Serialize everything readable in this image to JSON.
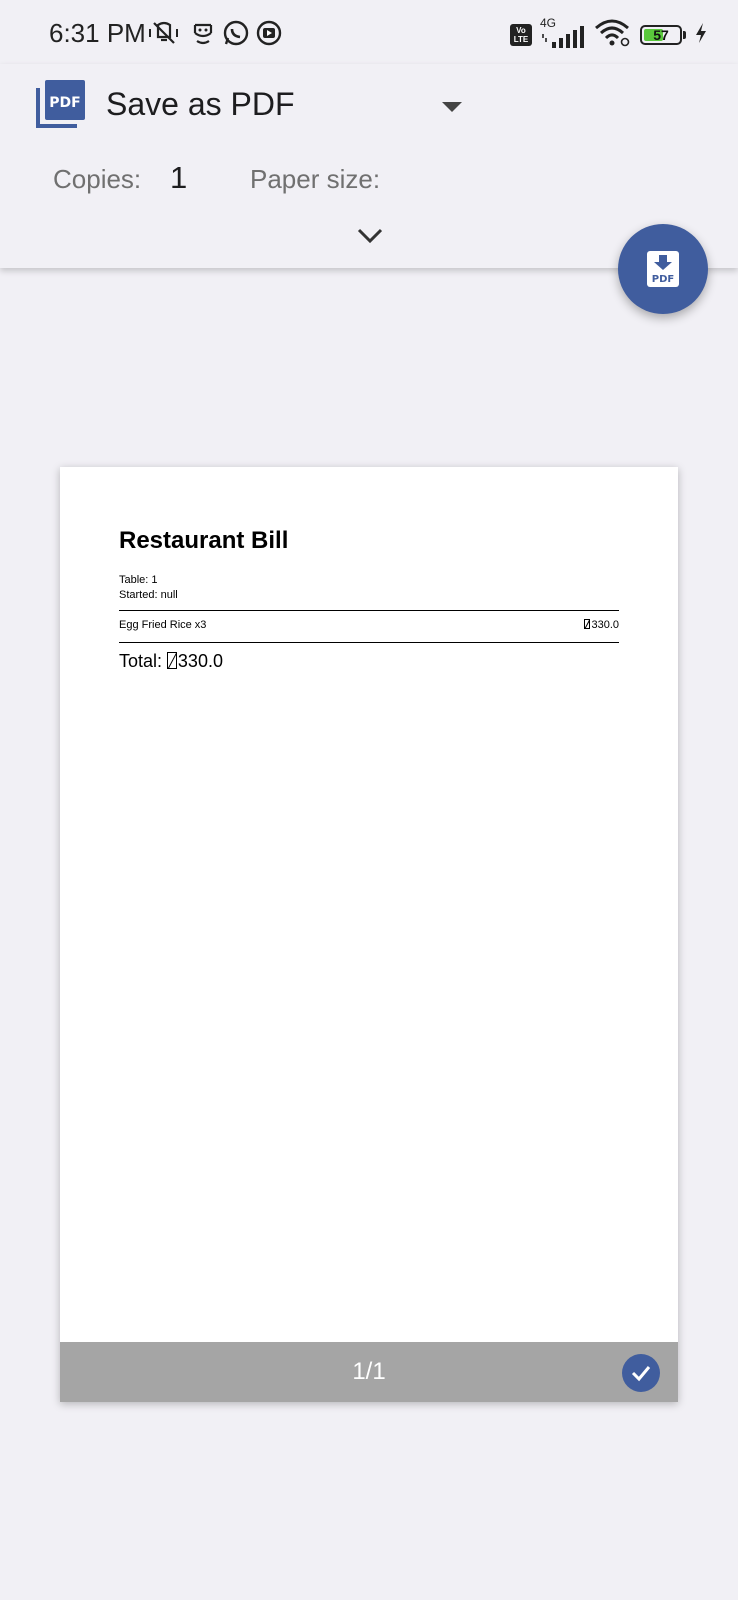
{
  "status_bar": {
    "time": "6:31 PM",
    "icons": [
      "vibrate-mute-icon",
      "face-icon",
      "whatsapp-icon",
      "youtube-icon"
    ],
    "network": "4G",
    "volte": "Vo LTE",
    "battery": "57",
    "battery_level": 57
  },
  "header": {
    "printer_icon_text": "PDF",
    "printer_name": "Save as PDF",
    "copies_label": "Copies:",
    "copies_value": "1",
    "paper_size_label": "Paper size:"
  },
  "fab": {
    "icon": "pdf-download-icon",
    "label": "PDF"
  },
  "preview": {
    "title": "Restaurant Bill",
    "table": "Table: 1",
    "started": "Started: null",
    "items": [
      {
        "name": "Egg Fried Rice x3",
        "price": "330.0"
      }
    ],
    "total_prefix": "Total: ",
    "total_value": "330.0",
    "page_counter": "1/1"
  },
  "colors": {
    "accent": "#405d9e",
    "background": "#f1f0f5",
    "footer": "#a5a5a5"
  }
}
